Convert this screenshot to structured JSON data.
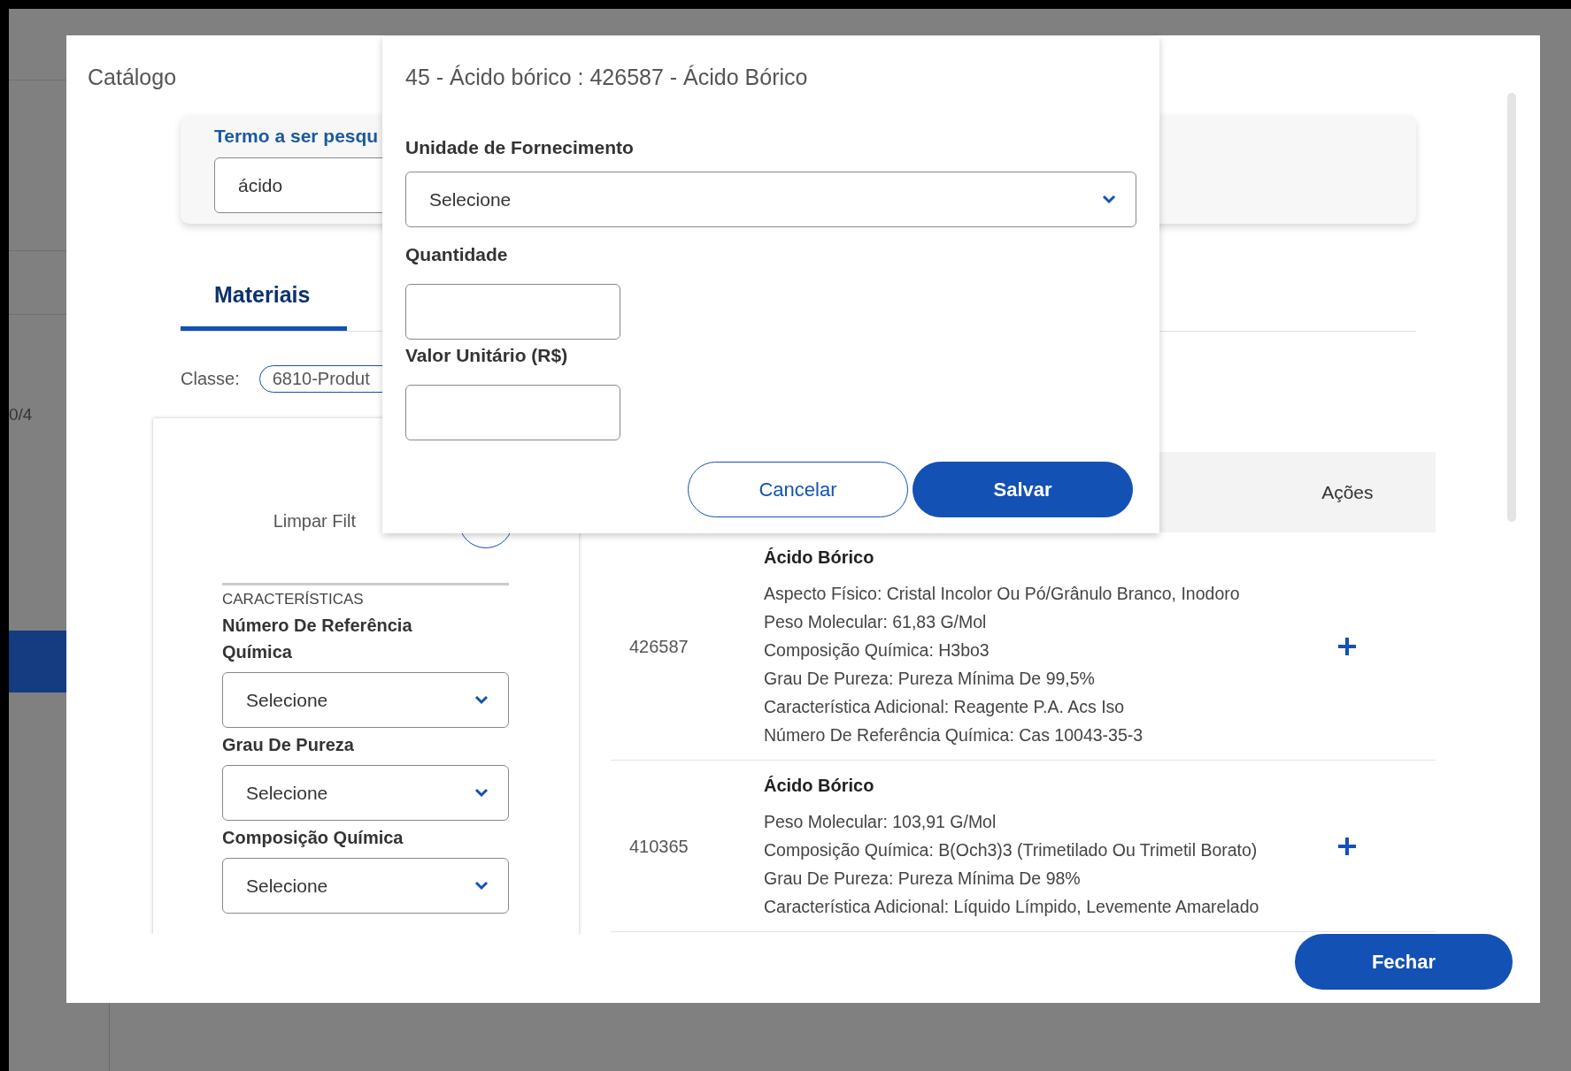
{
  "background": {
    "page_counter": "0/4"
  },
  "catalog": {
    "title": "Catálogo",
    "search": {
      "label": "Termo a ser pesqu",
      "value": "ácido"
    },
    "tabs": [
      {
        "label": "Materiais",
        "selected": true
      }
    ],
    "class_filter": {
      "label": "Classe:",
      "chip": "6810-Produt"
    },
    "filters": {
      "clear_label": "Limpar Filt",
      "section_title": "CARACTERÍSTICAS",
      "fields": [
        {
          "label": "Número De Referência Química",
          "value": "Selecione"
        },
        {
          "label": "Grau De Pureza",
          "value": "Selecione"
        },
        {
          "label": "Composição Química",
          "value": "Selecione"
        }
      ]
    },
    "table": {
      "columns": [
        {
          "label": "Ações"
        }
      ],
      "rows": [
        {
          "code": "426587",
          "title": "Ácido Bórico",
          "details": [
            "Aspecto Físico: Cristal Incolor Ou Pó/Grânulo Branco, Inodoro",
            "Peso Molecular: 61,83 G/Mol",
            "Composição Química: H3bo3",
            "Grau De Pureza: Pureza Mínima De 99,5%",
            "Característica Adicional: Reagente P.A. Acs Iso",
            "Número De Referência Química: Cas 10043-35-3"
          ]
        },
        {
          "code": "410365",
          "title": "Ácido Bórico",
          "details": [
            "Peso Molecular: 103,91 G/Mol",
            "Composição Química: B(Och3)3 (Trimetilado Ou Trimetil Borato)",
            "Grau De Pureza: Pureza Mínima De 98%",
            "Característica Adicional: Líquido Límpido, Levemente Amarelado"
          ]
        }
      ]
    },
    "close_button": "Fechar"
  },
  "dialog": {
    "title": "45 - Ácido bórico : 426587 - Ácido Bórico",
    "supply_unit": {
      "label": "Unidade de Fornecimento",
      "value": "Selecione"
    },
    "quantity": {
      "label": "Quantidade"
    },
    "unit_price": {
      "label": "Valor Unitário (R$)"
    },
    "buttons": [
      {
        "label": "Cancelar",
        "kind": "secondary"
      },
      {
        "label": "Salvar",
        "kind": "primary"
      }
    ]
  }
}
